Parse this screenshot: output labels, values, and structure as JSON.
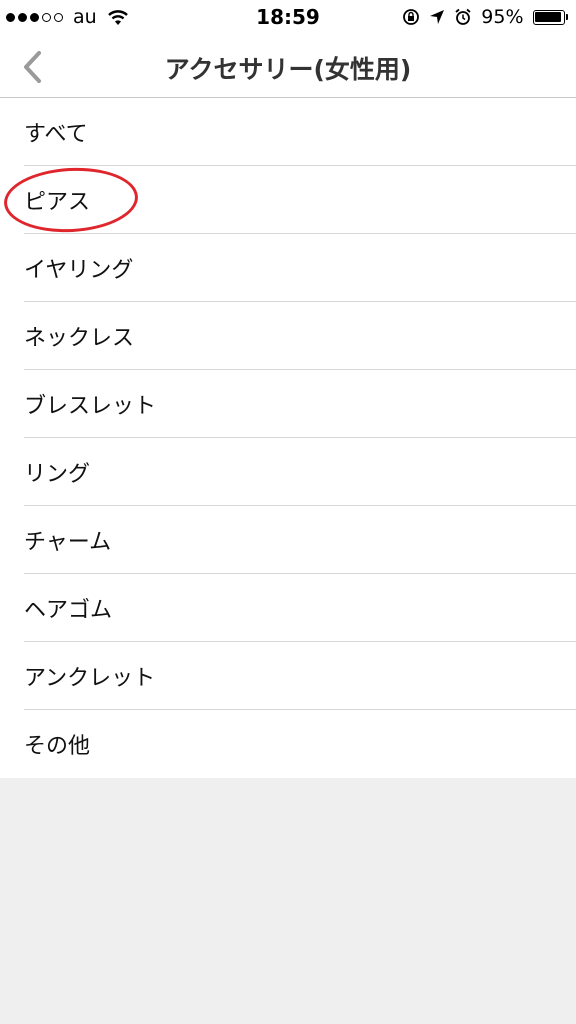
{
  "status_bar": {
    "signal_dots_filled": 3,
    "signal_dots_total": 5,
    "carrier": "au",
    "time": "18:59",
    "battery_percent": "95%",
    "battery_level": 0.95,
    "icons": [
      "wifi-icon",
      "rotation-lock-icon",
      "location-arrow-icon",
      "alarm-icon",
      "battery-icon"
    ]
  },
  "nav": {
    "title": "アクセサリー(女性用)",
    "back_icon": "chevron-left-icon"
  },
  "categories": [
    {
      "label": "すべて"
    },
    {
      "label": "ピアス",
      "highlighted": true
    },
    {
      "label": "イヤリング"
    },
    {
      "label": "ネックレス"
    },
    {
      "label": "ブレスレット"
    },
    {
      "label": "リング"
    },
    {
      "label": "チャーム"
    },
    {
      "label": "ヘアゴム"
    },
    {
      "label": "アンクレット"
    },
    {
      "label": "その他"
    }
  ],
  "colors": {
    "annotation_circle": "#e0262d",
    "background": "#efefef"
  }
}
